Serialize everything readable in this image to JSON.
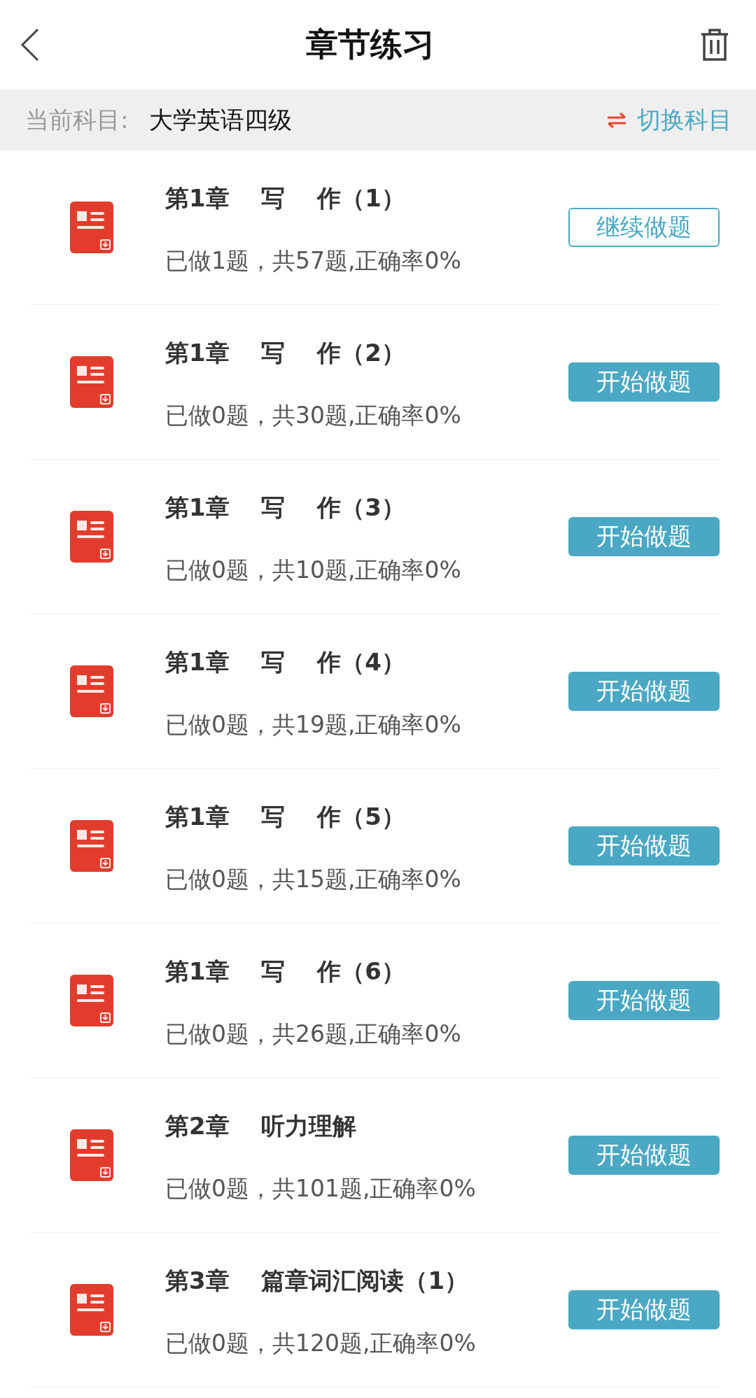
{
  "header": {
    "title": "章节练习"
  },
  "subject_bar": {
    "label": "当前科目:",
    "subject": "大学英语四级",
    "switch": "切换科目"
  },
  "chapters": [
    {
      "title": "第1章　 写　 作（1）",
      "progress": "已做1题，共57题,正确率0%",
      "button": {
        "label": "继续做题",
        "kind": "outline"
      }
    },
    {
      "title": "第1章　 写　 作（2）",
      "progress": "已做0题，共30题,正确率0%",
      "button": {
        "label": "开始做题",
        "kind": "filled"
      }
    },
    {
      "title": "第1章　 写　 作（3）",
      "progress": "已做0题，共10题,正确率0%",
      "button": {
        "label": "开始做题",
        "kind": "filled"
      }
    },
    {
      "title": "第1章　 写　 作（4）",
      "progress": "已做0题，共19题,正确率0%",
      "button": {
        "label": "开始做题",
        "kind": "filled"
      }
    },
    {
      "title": "第1章　 写　 作（5）",
      "progress": "已做0题，共15题,正确率0%",
      "button": {
        "label": "开始做题",
        "kind": "filled"
      }
    },
    {
      "title": "第1章　 写　 作（6）",
      "progress": "已做0题，共26题,正确率0%",
      "button": {
        "label": "开始做题",
        "kind": "filled"
      }
    },
    {
      "title": "第2章　 听力理解",
      "progress": "已做0题，共101题,正确率0%",
      "button": {
        "label": "开始做题",
        "kind": "filled"
      }
    },
    {
      "title": "第3章　 篇章词汇阅读（1）",
      "progress": "已做0题，共120题,正确率0%",
      "button": {
        "label": "开始做题",
        "kind": "filled"
      }
    }
  ]
}
